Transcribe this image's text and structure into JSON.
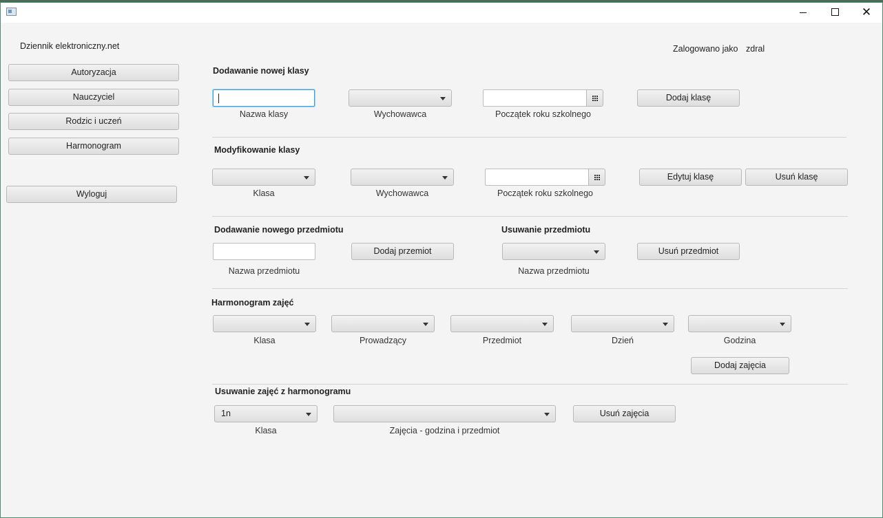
{
  "window": {
    "minimize_glyph": "",
    "close_glyph": "✕"
  },
  "app": {
    "name": "Dziennik elektroniczny.net",
    "login_label": "Zalogowano jako",
    "username": "zdral"
  },
  "sidebar": {
    "items": [
      {
        "label": "Autoryzacja"
      },
      {
        "label": "Nauczyciel"
      },
      {
        "label": "Rodzic i uczeń"
      },
      {
        "label": "Harmonogram"
      }
    ],
    "logout_label": "Wyloguj"
  },
  "add_class": {
    "heading": "Dodawanie nowej klasy",
    "name_value": "",
    "name_label": "Nazwa klasy",
    "teacher_value": "",
    "teacher_label": "Wychowawca",
    "year_value": "",
    "year_label": "Początek roku szkolnego",
    "submit_label": "Dodaj klasę"
  },
  "edit_class": {
    "heading": "Modyfikowanie klasy",
    "class_value": "",
    "class_label": "Klasa",
    "teacher_value": "",
    "teacher_label": "Wychowawca",
    "year_value": "",
    "year_label": "Początek roku szkolnego",
    "edit_label": "Edytuj klasę",
    "delete_label": "Usuń klasę"
  },
  "add_subject": {
    "heading": "Dodawanie nowego przedmiotu",
    "name_value": "",
    "name_label": "Nazwa przedmiotu",
    "submit_label": "Dodaj przemiot"
  },
  "delete_subject": {
    "heading": "Usuwanie przedmiotu",
    "subject_value": "",
    "subject_label": "Nazwa przedmiotu",
    "submit_label": "Usuń przedmiot"
  },
  "schedule": {
    "heading": "Harmonogram zajęć",
    "class_label": "Klasa",
    "teacher_label": "Prowadzący",
    "subject_label": "Przedmiot",
    "day_label": "Dzień",
    "hour_label": "Godzina",
    "submit_label": "Dodaj zajęcia"
  },
  "delete_lesson": {
    "heading": "Usuwanie zajęć z harmonogramu",
    "class_value": "1n",
    "class_label": "Klasa",
    "lesson_value": "",
    "lesson_label": "Zajęcia - godzina i przedmiot",
    "submit_label": "Usuń zajęcia"
  }
}
